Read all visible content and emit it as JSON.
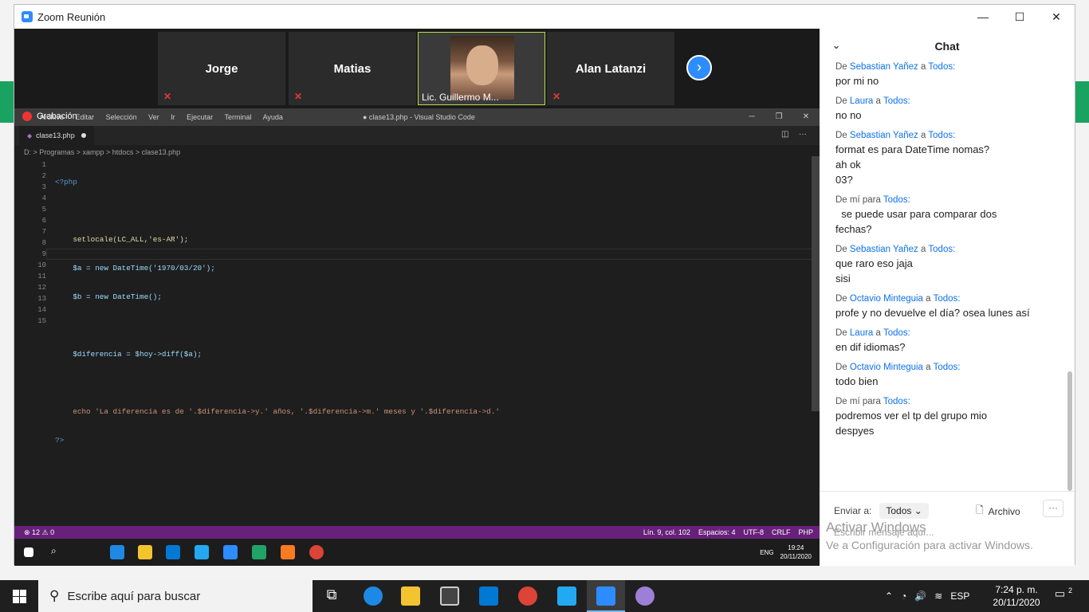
{
  "window": {
    "title": "Zoom Reunión",
    "minimize": "—",
    "maximize": "☐",
    "close": "✕"
  },
  "participants": [
    {
      "name": "Jorge"
    },
    {
      "name": "Matias"
    },
    {
      "name": "Lic. Guillermo M..."
    },
    {
      "name": "Alan Latanzi"
    }
  ],
  "next_icon": "chevron-right-icon",
  "recording": "Grabación",
  "vscode": {
    "menu": [
      "Archivo",
      "Editar",
      "Selección",
      "Ver",
      "Ir",
      "Ejecutar",
      "Terminal",
      "Ayuda"
    ],
    "title": "● clase13.php - Visual Studio Code",
    "tab": "clase13.php",
    "breadcrumb": "D: > Programas > xampp > htdocs > clase13.php",
    "line_numbers": [
      "1",
      "2",
      "3",
      "4",
      "5",
      "6",
      "7",
      "8",
      "9",
      "10",
      "11",
      "12",
      "13",
      "14",
      "15"
    ],
    "code_lines": [
      "<?php",
      "",
      "    setlocale(LC_ALL,'es-AR');",
      "    $a = new DateTime('1970/03/20');",
      "    $b = new DateTime();",
      "",
      "    $diferencia = $hoy->diff($a);",
      "",
      "    echo 'La diferencia es de '.$diferencia->y.' años, '.$diferencia->m.' meses y '.$diferencia->d.' ",
      "?>",
      "",
      "",
      "",
      "",
      ""
    ],
    "status_left": "⊗ 12 ⚠ 0",
    "status_right": [
      "Lín. 9, col. 102",
      "Espacios: 4",
      "UTF-8",
      "CRLF",
      "PHP"
    ],
    "inner_clock": {
      "time": "19:24",
      "date": "20/11/2020"
    },
    "inner_lang": "ENG"
  },
  "chat": {
    "title": "Chat",
    "messages": [
      {
        "prefix": "De",
        "from": "Sebastian Yañez",
        "mid": "a",
        "to": "Todos:",
        "lines": [
          "por mi no"
        ]
      },
      {
        "prefix": "De",
        "from": "Laura",
        "mid": "a",
        "to": "Todos:",
        "lines": [
          "no no"
        ]
      },
      {
        "prefix": "De",
        "from": "Sebastian Yañez",
        "mid": "a",
        "to": "Todos:",
        "lines": [
          "format es para DateTime nomas?",
          "ah ok",
          "03?"
        ]
      },
      {
        "prefix": "De mí para",
        "from": "",
        "mid": "",
        "to": "Todos:",
        "lines": [
          "  se puede usar para comparar dos",
          "fechas?"
        ]
      },
      {
        "prefix": "De",
        "from": "Sebastian Yañez",
        "mid": "a",
        "to": "Todos:",
        "lines": [
          "que raro eso jaja",
          "sisi"
        ]
      },
      {
        "prefix": "De",
        "from": "Octavio Minteguia",
        "mid": "a",
        "to": "Todos:",
        "lines": [
          "profe y no devuelve el día? osea lunes así"
        ]
      },
      {
        "prefix": "De",
        "from": "Laura",
        "mid": "a",
        "to": "Todos:",
        "lines": [
          "en dif idiomas?"
        ]
      },
      {
        "prefix": "De",
        "from": "Octavio Minteguia",
        "mid": "a",
        "to": "Todos:",
        "lines": [
          "todo bien"
        ]
      },
      {
        "prefix": "De mí para",
        "from": "",
        "mid": "",
        "to": "Todos:",
        "lines": [
          "podremos ver el tp del grupo mio",
          "despyes"
        ]
      }
    ],
    "send_to_label": "Enviar a:",
    "send_to_value": "Todos",
    "file_label": "Archivo",
    "more": "···",
    "input_placeholder": "Escribir mensaje aquí..."
  },
  "watermark": {
    "line1": "Activar Windows",
    "line2": "Ve a Configuración para activar Windows."
  },
  "taskbar": {
    "search_placeholder": "Escribe aquí para buscar",
    "lang": "ESP",
    "time": "7:24 p. m.",
    "date": "20/11/2020",
    "notifications": "2"
  }
}
